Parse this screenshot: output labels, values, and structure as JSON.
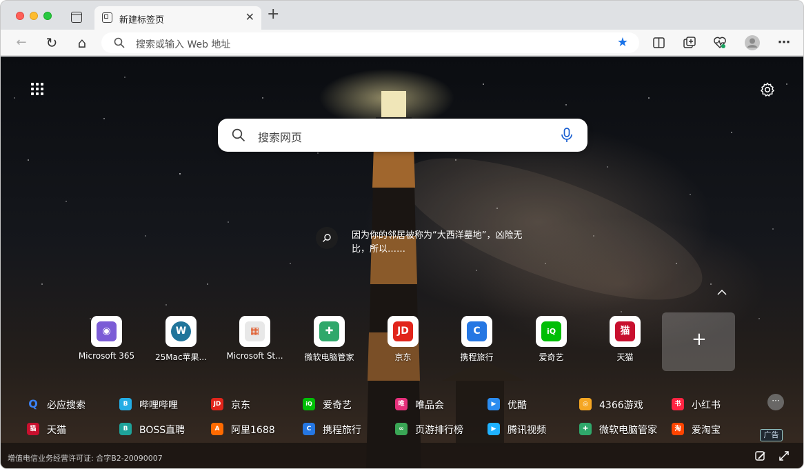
{
  "tab": {
    "title": "新建标签页",
    "close": "✕"
  },
  "new_tab_glyph": "+",
  "toolbar": {
    "back_icon": "←",
    "refresh_icon": "↻",
    "home_icon": "⌂",
    "address_placeholder": "搜索或输入 Web 地址",
    "favorite_icon": "★",
    "split_icon": "split-screen-icon",
    "collections_icon": "collections-icon",
    "performance_icon": "heart-pulse-icon",
    "profile_icon": "profile-avatar-icon",
    "menu_icon": "⋯"
  },
  "search": {
    "placeholder": "搜索网页"
  },
  "fact": {
    "text": "因为你的邻居被称为“大西洋墓地”，凶险无比，所以……"
  },
  "quick_links": [
    {
      "label": "Microsoft 365",
      "color": "#7b5cd6",
      "glyph": "◉"
    },
    {
      "label": "25Mac苹果...",
      "color": "#21759b",
      "glyph": "W"
    },
    {
      "label": "Microsoft St...",
      "color": "#e8e8e8",
      "glyph": "▦"
    },
    {
      "label": "微软电脑管家",
      "color": "#2fa86b",
      "glyph": "✚"
    },
    {
      "label": "京东",
      "color": "#e1251b",
      "glyph": "JD"
    },
    {
      "label": "携程旅行",
      "color": "#2577e3",
      "glyph": "C"
    },
    {
      "label": "爱奇艺",
      "color": "#00be06",
      "glyph": "iQ"
    },
    {
      "label": "天猫",
      "color": "#c8102e",
      "glyph": "猫"
    }
  ],
  "add_link": "+",
  "links_panel": [
    {
      "label": "必应搜索",
      "color": "#1b5fd1",
      "glyph": "Q"
    },
    {
      "label": "哔哩哔哩",
      "color": "#23ade5",
      "glyph": "B"
    },
    {
      "label": "京东",
      "color": "#e1251b",
      "glyph": "JD"
    },
    {
      "label": "爱奇艺",
      "color": "#00be06",
      "glyph": "iQ"
    },
    {
      "label": "唯品会",
      "color": "#e5307b",
      "glyph": "唯"
    },
    {
      "label": "优酷",
      "color": "#2b8cf0",
      "glyph": "▶"
    },
    {
      "label": "4366游戏",
      "color": "#f5a623",
      "glyph": "◎"
    },
    {
      "label": "小红书",
      "color": "#ff2442",
      "glyph": "书"
    },
    {
      "label": "天猫",
      "color": "#c8102e",
      "glyph": "猫"
    },
    {
      "label": "BOSS直聘",
      "color": "#1ea39a",
      "glyph": "B"
    },
    {
      "label": "阿里1688",
      "color": "#ff6a00",
      "glyph": "A"
    },
    {
      "label": "携程旅行",
      "color": "#2577e3",
      "glyph": "C"
    },
    {
      "label": "页游排行榜",
      "color": "#3aa655",
      "glyph": "∞"
    },
    {
      "label": "腾讯视频",
      "color": "#1fb2ff",
      "glyph": "▶"
    },
    {
      "label": "微软电脑管家",
      "color": "#2fa86b",
      "glyph": "✚"
    },
    {
      "label": "爱淘宝",
      "color": "#ff4400",
      "glyph": "淘"
    }
  ],
  "more_button": "···",
  "ad_badge": "广告",
  "license": "增值电信业务经营许可证: 合字B2-20090007"
}
